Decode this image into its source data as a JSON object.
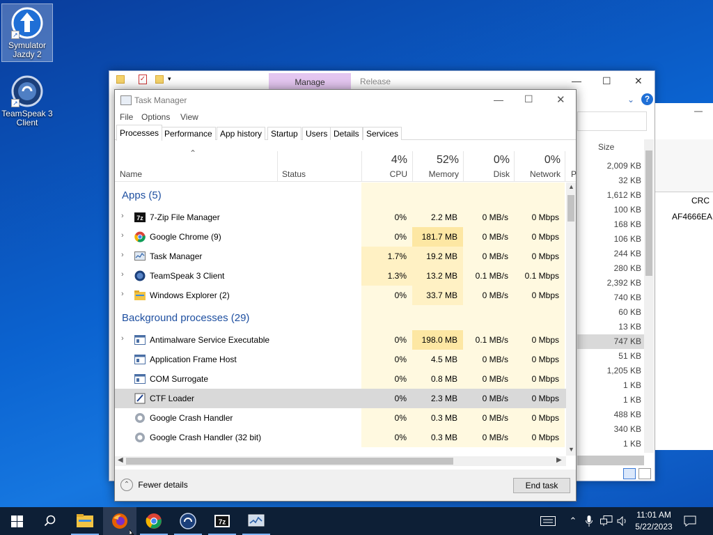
{
  "desktop": {
    "icons": [
      {
        "label": "Symulator Jazdy 2"
      },
      {
        "label": "TeamSpeak 3 Client"
      }
    ]
  },
  "bg_window": {
    "manage_tab": "Manage",
    "release_tab": "Release",
    "size_header": "Size",
    "sizes": [
      "2,009 KB",
      "32 KB",
      "1,612 KB",
      "100 KB",
      "168 KB",
      "106 KB",
      "244 KB",
      "280 KB",
      "2,392 KB",
      "740 KB",
      "60 KB",
      "13 KB",
      "747 KB",
      "51 KB",
      "1,205 KB",
      "1 KB",
      "1 KB",
      "488 KB",
      "340 KB",
      "1 KB"
    ],
    "crc_header": "CRC",
    "crc_value": "AF4666EA"
  },
  "task_manager": {
    "title": "Task Manager",
    "menu": [
      "File",
      "Options",
      "View"
    ],
    "tabs": [
      "Processes",
      "Performance",
      "App history",
      "Startup",
      "Users",
      "Details",
      "Services"
    ],
    "columns": {
      "name": "Name",
      "status": "Status",
      "cpu": {
        "pct": "4%",
        "label": "CPU"
      },
      "memory": {
        "pct": "52%",
        "label": "Memory"
      },
      "disk": {
        "pct": "0%",
        "label": "Disk"
      },
      "network": {
        "pct": "0%",
        "label": "Network"
      },
      "power": "P"
    },
    "groups": {
      "apps": "Apps (5)",
      "background": "Background processes (29)"
    },
    "apps": [
      {
        "name": "7-Zip File Manager",
        "cpu": "0%",
        "mem": "2.2 MB",
        "disk": "0 MB/s",
        "net": "0 Mbps"
      },
      {
        "name": "Google Chrome (9)",
        "cpu": "0%",
        "mem": "181.7 MB",
        "disk": "0 MB/s",
        "net": "0 Mbps"
      },
      {
        "name": "Task Manager",
        "cpu": "1.7%",
        "mem": "19.2 MB",
        "disk": "0 MB/s",
        "net": "0 Mbps"
      },
      {
        "name": "TeamSpeak 3 Client",
        "cpu": "1.3%",
        "mem": "13.2 MB",
        "disk": "0.1 MB/s",
        "net": "0.1 Mbps"
      },
      {
        "name": "Windows Explorer (2)",
        "cpu": "0%",
        "mem": "33.7 MB",
        "disk": "0 MB/s",
        "net": "0 Mbps"
      }
    ],
    "background": [
      {
        "name": "Antimalware Service Executable",
        "cpu": "0%",
        "mem": "198.0 MB",
        "disk": "0.1 MB/s",
        "net": "0 Mbps"
      },
      {
        "name": "Application Frame Host",
        "cpu": "0%",
        "mem": "4.5 MB",
        "disk": "0 MB/s",
        "net": "0 Mbps"
      },
      {
        "name": "COM Surrogate",
        "cpu": "0%",
        "mem": "0.8 MB",
        "disk": "0 MB/s",
        "net": "0 Mbps"
      },
      {
        "name": "CTF Loader",
        "cpu": "0%",
        "mem": "2.3 MB",
        "disk": "0 MB/s",
        "net": "0 Mbps"
      },
      {
        "name": "Google Crash Handler",
        "cpu": "0%",
        "mem": "0.3 MB",
        "disk": "0 MB/s",
        "net": "0 Mbps"
      },
      {
        "name": "Google Crash Handler (32 bit)",
        "cpu": "0%",
        "mem": "0.3 MB",
        "disk": "0 MB/s",
        "net": "0 Mbps"
      }
    ],
    "fewer_details": "Fewer details",
    "end_task": "End task"
  },
  "taskbar": {
    "time": "11:01 AM",
    "date": "5/22/2023"
  },
  "colors": {
    "heat_light": "#fff9e0",
    "heat_mid": "#fff1c4",
    "heat_strong": "#fde7a3",
    "group_title": "#1e4fa0"
  }
}
